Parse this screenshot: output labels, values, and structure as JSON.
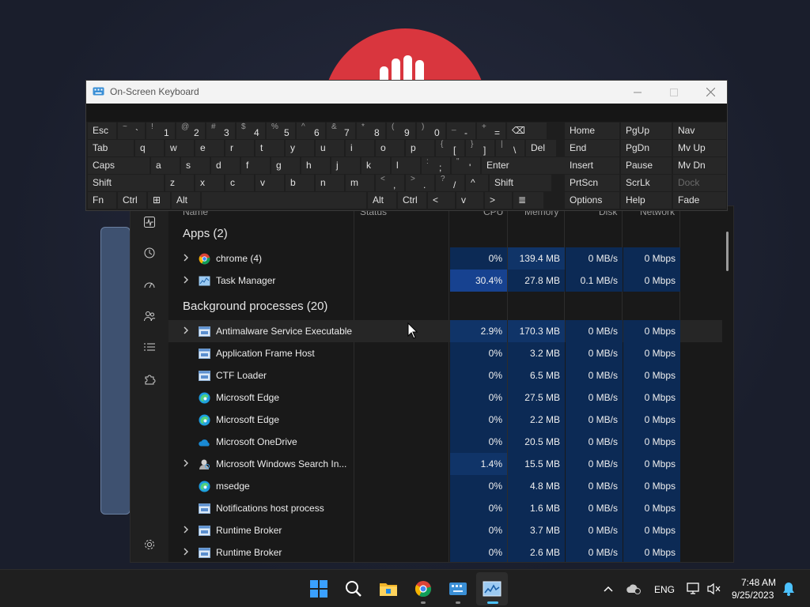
{
  "osk": {
    "title": "On-Screen Keyboard",
    "rows": [
      [
        {
          "label": "Esc"
        },
        {
          "shift": "~",
          "main": "`"
        },
        {
          "shift": "!",
          "main": "1"
        },
        {
          "shift": "@",
          "main": "2"
        },
        {
          "shift": "#",
          "main": "3"
        },
        {
          "shift": "$",
          "main": "4"
        },
        {
          "shift": "%",
          "main": "5"
        },
        {
          "shift": "^",
          "main": "6"
        },
        {
          "shift": "&",
          "main": "7"
        },
        {
          "shift": "*",
          "main": "8"
        },
        {
          "shift": "(",
          "main": "9"
        },
        {
          "shift": ")",
          "main": "0"
        },
        {
          "shift": "_",
          "main": "-"
        },
        {
          "shift": "+",
          "main": "="
        },
        {
          "label": "⌫"
        }
      ],
      [
        {
          "label": "Tab"
        },
        {
          "label": "q"
        },
        {
          "label": "w"
        },
        {
          "label": "e"
        },
        {
          "label": "r"
        },
        {
          "label": "t"
        },
        {
          "label": "y"
        },
        {
          "label": "u"
        },
        {
          "label": "i"
        },
        {
          "label": "o"
        },
        {
          "label": "p"
        },
        {
          "shift": "{",
          "main": "["
        },
        {
          "shift": "}",
          "main": "]"
        },
        {
          "shift": "|",
          "main": "\\"
        },
        {
          "label": "Del"
        }
      ],
      [
        {
          "label": "Caps"
        },
        {
          "label": "a"
        },
        {
          "label": "s"
        },
        {
          "label": "d"
        },
        {
          "label": "f"
        },
        {
          "label": "g"
        },
        {
          "label": "h"
        },
        {
          "label": "j"
        },
        {
          "label": "k"
        },
        {
          "label": "l"
        },
        {
          "shift": ":",
          "main": ";"
        },
        {
          "shift": "\"",
          "main": "'"
        },
        {
          "label": "Enter"
        }
      ],
      [
        {
          "label": "Shift"
        },
        {
          "label": "z"
        },
        {
          "label": "x"
        },
        {
          "label": "c"
        },
        {
          "label": "v"
        },
        {
          "label": "b"
        },
        {
          "label": "n"
        },
        {
          "label": "m"
        },
        {
          "shift": "<",
          "main": ","
        },
        {
          "shift": ">",
          "main": "."
        },
        {
          "shift": "?",
          "main": "/"
        },
        {
          "label": "^"
        },
        {
          "label": "Shift"
        }
      ],
      [
        {
          "label": "Fn"
        },
        {
          "label": "Ctrl"
        },
        {
          "label": "⊞"
        },
        {
          "label": "Alt"
        },
        {
          "label": ""
        },
        {
          "label": "Alt"
        },
        {
          "label": "Ctrl"
        },
        {
          "label": "<"
        },
        {
          "label": "v"
        },
        {
          "label": ">"
        },
        {
          "label": "≣"
        }
      ]
    ],
    "side": [
      [
        "Home",
        "PgUp",
        "Nav"
      ],
      [
        "End",
        "PgDn",
        "Mv Up"
      ],
      [
        "Insert",
        "Pause",
        "Mv Dn"
      ],
      [
        "PrtScn",
        "ScrLk",
        "Dock"
      ],
      [
        "Options",
        "Help",
        "Fade"
      ]
    ]
  },
  "taskmgr": {
    "columns": {
      "name": "Name",
      "status": "Status",
      "cpu": "CPU",
      "memory": "Memory",
      "disk": "Disk",
      "network": "Network"
    },
    "groups": [
      {
        "title": "Apps (2)",
        "rows": [
          {
            "name": "chrome (4)",
            "icon": "chrome-icon",
            "expand": true,
            "cpu": "0%",
            "mem": "139.4 MB",
            "disk": "0 MB/s",
            "net": "0 Mbps",
            "cpuHeat": 1,
            "memHeat": 2
          },
          {
            "name": "Task Manager",
            "icon": "task-manager-icon",
            "expand": true,
            "cpu": "30.4%",
            "mem": "27.8 MB",
            "disk": "0.1 MB/s",
            "net": "0 Mbps",
            "cpuHeat": 3,
            "memHeat": 1
          }
        ]
      },
      {
        "title": "Background processes (20)",
        "rows": [
          {
            "name": "Antimalware Service Executable",
            "icon": "service-icon",
            "expand": true,
            "cpu": "2.9%",
            "mem": "170.3 MB",
            "disk": "0 MB/s",
            "net": "0 Mbps",
            "cpuHeat": 2,
            "memHeat": 2
          },
          {
            "name": "Application Frame Host",
            "icon": "service-icon",
            "expand": false,
            "cpu": "0%",
            "mem": "3.2 MB",
            "disk": "0 MB/s",
            "net": "0 Mbps",
            "cpuHeat": 1,
            "memHeat": 1
          },
          {
            "name": "CTF Loader",
            "icon": "service-icon",
            "expand": false,
            "cpu": "0%",
            "mem": "6.5 MB",
            "disk": "0 MB/s",
            "net": "0 Mbps",
            "cpuHeat": 1,
            "memHeat": 1
          },
          {
            "name": "Microsoft Edge",
            "icon": "edge-icon",
            "expand": false,
            "cpu": "0%",
            "mem": "27.5 MB",
            "disk": "0 MB/s",
            "net": "0 Mbps",
            "cpuHeat": 1,
            "memHeat": 1
          },
          {
            "name": "Microsoft Edge",
            "icon": "edge-icon",
            "expand": false,
            "cpu": "0%",
            "mem": "2.2 MB",
            "disk": "0 MB/s",
            "net": "0 Mbps",
            "cpuHeat": 1,
            "memHeat": 1
          },
          {
            "name": "Microsoft OneDrive",
            "icon": "onedrive-icon",
            "expand": false,
            "cpu": "0%",
            "mem": "20.5 MB",
            "disk": "0 MB/s",
            "net": "0 Mbps",
            "cpuHeat": 1,
            "memHeat": 1
          },
          {
            "name": "Microsoft Windows Search In...",
            "icon": "search-indexer-icon",
            "expand": true,
            "cpu": "1.4%",
            "mem": "15.5 MB",
            "disk": "0 MB/s",
            "net": "0 Mbps",
            "cpuHeat": 2,
            "memHeat": 1
          },
          {
            "name": "msedge",
            "icon": "edge-icon",
            "expand": false,
            "cpu": "0%",
            "mem": "4.8 MB",
            "disk": "0 MB/s",
            "net": "0 Mbps",
            "cpuHeat": 1,
            "memHeat": 1
          },
          {
            "name": "Notifications host process",
            "icon": "service-icon",
            "expand": false,
            "cpu": "0%",
            "mem": "1.6 MB",
            "disk": "0 MB/s",
            "net": "0 Mbps",
            "cpuHeat": 1,
            "memHeat": 1
          },
          {
            "name": "Runtime Broker",
            "icon": "service-icon",
            "expand": true,
            "cpu": "0%",
            "mem": "3.7 MB",
            "disk": "0 MB/s",
            "net": "0 Mbps",
            "cpuHeat": 1,
            "memHeat": 1
          },
          {
            "name": "Runtime Broker",
            "icon": "service-icon",
            "expand": true,
            "cpu": "0%",
            "mem": "2.6 MB",
            "disk": "0 MB/s",
            "net": "0 Mbps",
            "cpuHeat": 1,
            "memHeat": 1
          }
        ]
      }
    ]
  },
  "taskbar": {
    "language": "ENG",
    "time": "7:48 AM",
    "date": "9/25/2023"
  },
  "colors": {
    "accent": "#0078d4",
    "heat1": "#0c2a55",
    "heat2": "#103468",
    "heat3": "#174290"
  }
}
